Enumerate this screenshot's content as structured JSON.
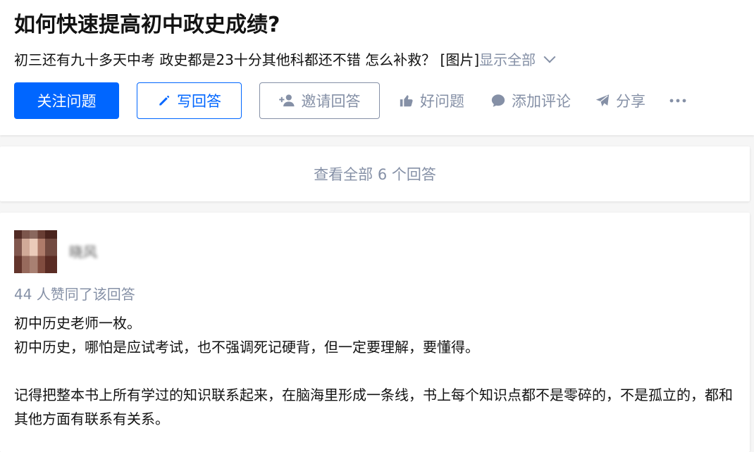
{
  "question": {
    "title": "如何快速提高初中政史成绩?",
    "detail": "初三还有九十多天中考 政史都是23十分其他科都还不错 怎么补救？ [图片]",
    "show_all": "显示全部"
  },
  "actions": {
    "follow": "关注问题",
    "write": "写回答",
    "invite": "邀请回答",
    "good_question": "好问题",
    "comment": "添加评论",
    "share": "分享",
    "more": "···"
  },
  "view_all": "查看全部 6 个回答",
  "answer": {
    "author": "晓风",
    "votes": "44 人赞同了该回答",
    "paragraphs": [
      "初中历史老师一枚。",
      "初中历史，哪怕是应试考试，也不强调死记硬背，但一定要理解，要懂得。",
      "记得把整本书上所有学过的知识联系起来，在脑海里形成一条线，书上每个知识点都不是零碎的，不是孤立的，都和其他方面有联系有关系。"
    ]
  },
  "colors": {
    "brand": "#0066ff",
    "muted": "#8590a6",
    "text": "#121212",
    "background": "#f6f6f6"
  },
  "icons": [
    "pencil-icon",
    "add-user-icon",
    "thumbs-up-icon",
    "comment-bubble-icon",
    "paper-plane-icon",
    "more-icon",
    "chevron-down-icon"
  ]
}
